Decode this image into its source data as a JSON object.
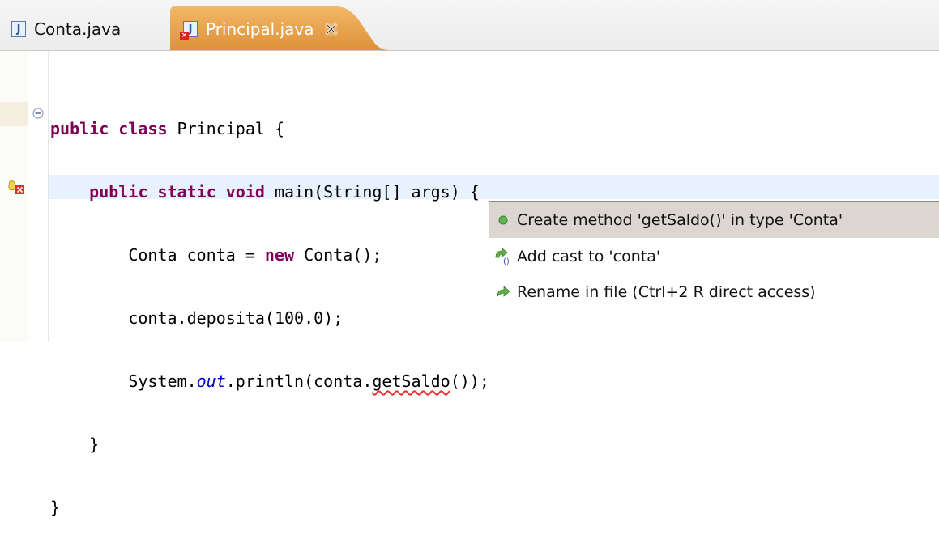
{
  "tabs": [
    {
      "label": "Conta.java",
      "icon": "java-file-icon",
      "active": false
    },
    {
      "label": "Principal.java",
      "icon": "java-file-error-icon",
      "active": true
    }
  ],
  "colors": {
    "active_tab": "#e8a34d",
    "keyword": "#7f0055",
    "field": "#0000c0",
    "current_line": "#e8f2fe",
    "selection": "#dbd6d0",
    "error": "#e3322f"
  },
  "code": {
    "l1_kw": "public class",
    "l1_rest": " Principal {",
    "l2_kw": "public static void",
    "l2_rest": " main(String[] args) {",
    "l3_a": "Conta conta = ",
    "l3_kw": "new",
    "l3_b": " Conta();",
    "l4": "conta.deposita(100.0);",
    "l5_a": "System.",
    "l5_field": "out",
    "l5_b": ".println(conta.",
    "l5_err": "getSaldo",
    "l5_c": "());",
    "l6": "}",
    "l7": "}"
  },
  "quick_fix": {
    "items": [
      {
        "label": "Create method 'getSaldo()' in type 'Conta'",
        "icon": "green-dot-icon",
        "selected": true
      },
      {
        "label": "Add cast to 'conta'",
        "icon": "cast-icon",
        "selected": false
      },
      {
        "label": "Rename in file (Ctrl+2 R direct access)",
        "icon": "rename-arrow-icon",
        "selected": false
      }
    ]
  }
}
